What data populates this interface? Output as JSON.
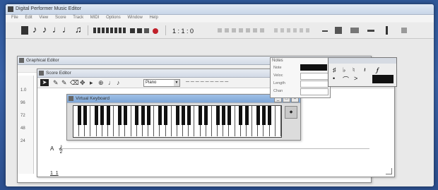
{
  "window": {
    "title": "Digital Performer Music Editor"
  },
  "menu": [
    "File",
    "Edit",
    "View",
    "Score",
    "Track",
    "MIDI",
    "Options",
    "Window",
    "Help"
  ],
  "toolbar": {
    "note_glyphs": [
      "♪",
      "♪",
      "♩",
      "♩",
      "♫"
    ],
    "counter": "1 : 1 : 0"
  },
  "editor_window": {
    "title": "Graphical Editor"
  },
  "score_window": {
    "title": "Score Editor",
    "dropdown_value": "Piano",
    "track_label": "A",
    "bottom_label": "1_1"
  },
  "ruler_numbers": [
    "1.0",
    "96",
    "72",
    "48",
    "24"
  ],
  "keyboard_window": {
    "title": "Virtual Keyboard"
  },
  "panel": {
    "title": "Notes",
    "rows": [
      "Note",
      "Veloc",
      "Length",
      "Chan"
    ]
  },
  "colors": {
    "record": "#c0202a",
    "title_active": "#7ea7d8"
  }
}
